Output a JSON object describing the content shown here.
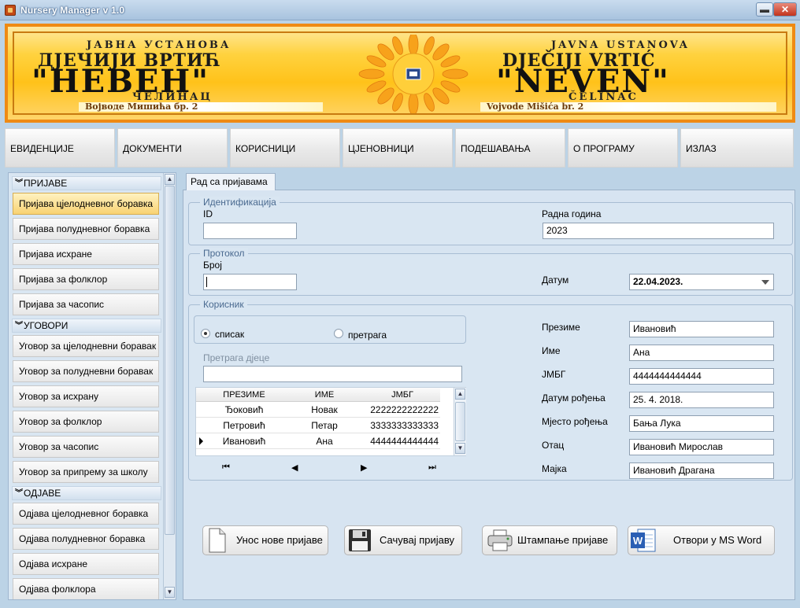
{
  "window": {
    "title": "Nursery Manager  v 1.0",
    "minimize_glyph": "▬",
    "close_glyph": "✕"
  },
  "banner": {
    "left": {
      "line1": "ЈАВНА УСТАНОВА",
      "line2": "ДЈЕЧИЈИ ВРТИЋ",
      "line3": "\"НЕВЕН\"",
      "line4": "ЧЕЛИНАЦ",
      "address": "Војводе Мишића бр. 2"
    },
    "right": {
      "line1": "JAVNA USTANOVA",
      "line2": "DJEČIJI VRTIĆ",
      "line3": "\"NEVEN\"",
      "line4": "ČELINAC",
      "address": "Vojvode Mišića br. 2"
    }
  },
  "nav": {
    "items": [
      "ЕВИДЕНЦИЈЕ",
      "ДОКУМЕНТИ",
      "КОРИСНИЦИ",
      "ЦЈЕНОВНИЦИ",
      "ПОДЕШАВАЊА",
      "О ПРОГРАМУ",
      "ИЗЛАЗ"
    ]
  },
  "sidebar": {
    "sections": [
      {
        "title": "ПРИЈАВЕ",
        "items": [
          "Пријава цјелодневног боравка",
          "Пријава полудневног боравка",
          "Пријава исхране",
          "Пријава за фолклор",
          "Пријава за часопис"
        ]
      },
      {
        "title": "УГОВОРИ",
        "items": [
          "Уговор за цјелодневни боравак",
          "Уговор за полудневни боравак",
          "Уговор за исхрану",
          "Уговор за фолклор",
          "Уговор за часопис",
          "Уговор за припрему за школу"
        ]
      },
      {
        "title": "ОДЈАВЕ",
        "items": [
          "Одјава цјелодневног боравка",
          "Одјава полудневног боравка",
          "Одјава исхране",
          "Одјава фолклора"
        ]
      }
    ],
    "active_item": "Пријава цјелодневног боравка"
  },
  "tab": {
    "label": "Рад са пријавама"
  },
  "identification": {
    "title": "Идентификација",
    "id_label": "ID",
    "id_value": "",
    "year_label": "Радна година",
    "year_value": "2023"
  },
  "protocol": {
    "title": "Протокол",
    "number_label": "Број",
    "number_value": "",
    "date_label": "Датум",
    "date_value": "22.04.2023."
  },
  "user": {
    "title": "Корисник",
    "radio_list": "списак",
    "radio_search": "претрага",
    "selected_radio": "списак",
    "search_label": "Претрага дјеце",
    "search_value": "",
    "grid": {
      "columns": [
        "ПРЕЗИМЕ",
        "ИМЕ",
        "ЈМБГ"
      ],
      "rows": [
        [
          "Ђоковић",
          "Новак",
          "2222222222222"
        ],
        [
          "Петровић",
          "Петар",
          "3333333333333"
        ],
        [
          "Ивановић",
          "Ана",
          "4444444444444"
        ]
      ],
      "current_row": 2
    },
    "pager": {
      "first": "⏮",
      "prev": "◀",
      "next": "▶",
      "last": "⏭"
    },
    "fields": [
      {
        "label": "Презиме",
        "value": "Ивановић"
      },
      {
        "label": "Име",
        "value": "Ана"
      },
      {
        "label": "ЈМБГ",
        "value": "4444444444444"
      },
      {
        "label": "Датум рођења",
        "value": "25. 4. 2018."
      },
      {
        "label": "Мјесто рођења",
        "value": "Бања Лука"
      },
      {
        "label": "Отац",
        "value": "Ивановић Мирослав"
      },
      {
        "label": "Мајка",
        "value": "Ивановић Драгана"
      }
    ]
  },
  "actions": {
    "new": "Унос нове пријаве",
    "save": "Сачувај пријаву",
    "print": "Штампање пријаве",
    "word": "Отвори у MS Word",
    "word_icon_text": "W"
  },
  "colors": {
    "banner_border": "#ef8a13",
    "banner_fill": "#ffc21a",
    "active_item": "#f8d272",
    "panel_bg": "#d7e4f1",
    "group_title": "#4a6a90"
  }
}
